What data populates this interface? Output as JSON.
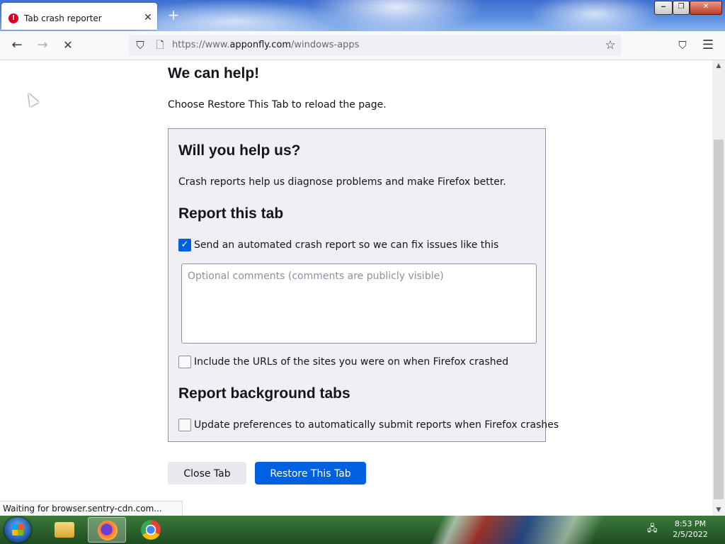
{
  "browser": {
    "tab": {
      "title": "Tab crash reporter",
      "alert_icon": "!",
      "close_icon": "✕"
    },
    "new_tab_icon": "+",
    "window_controls": {
      "minimize": "‒",
      "restore": "❐",
      "close": "✕"
    },
    "nav": {
      "back_icon": "←",
      "forward_icon": "→",
      "stop_icon": "✕"
    },
    "url": {
      "prefix": "https://www.",
      "host": "apponfly.com",
      "path": "/windows-apps"
    },
    "url_icons": {
      "shield": "⛉",
      "page": "🗋"
    },
    "bookmark_icon": "☆",
    "pocket_icon": "⛉",
    "menu_icon": "☰"
  },
  "page": {
    "heading": "We can help!",
    "subtext": "Choose Restore This Tab to reload the page.",
    "panel": {
      "help_heading": "Will you help us?",
      "help_text": "Crash reports help us diagnose problems and make Firefox better.",
      "report_heading": "Report this tab",
      "send_report_label": "Send an automated crash report so we can fix issues like this",
      "send_report_checked": true,
      "comments_placeholder": "Optional comments (comments are publicly visible)",
      "include_urls_label": "Include the URLs of the sites you were on when Firefox crashed",
      "include_urls_checked": false,
      "background_heading": "Report background tabs",
      "auto_submit_label": "Update preferences to automatically submit reports when Firefox crashes",
      "auto_submit_checked": false
    },
    "buttons": {
      "close_tab": "Close Tab",
      "restore_tab": "Restore This Tab"
    }
  },
  "status_text": "Waiting for browser.sentry-cdn.com...",
  "scrollbar": {
    "up_icon": "▲",
    "down_icon": "▼"
  },
  "taskbar": {
    "clock_time": "8:53 PM",
    "clock_date": "2/5/2022",
    "network_icon": "🖧"
  },
  "colors": {
    "accent": "#0061e0",
    "alert": "#d70022"
  }
}
